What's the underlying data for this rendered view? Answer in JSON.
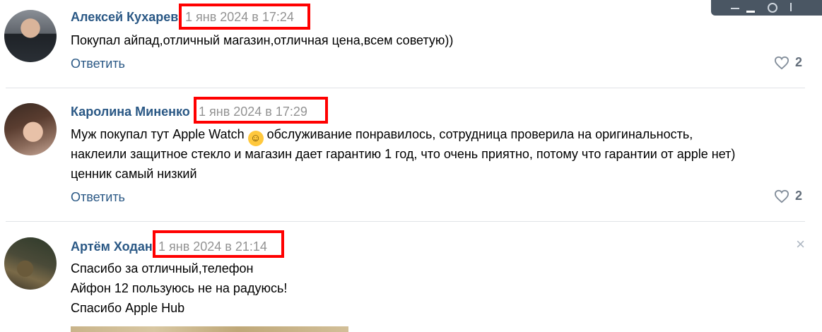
{
  "comments": [
    {
      "author": "Алексей Кухарев",
      "date": "1 янв 2024 в 17:24",
      "lines": [
        "Покупал айпад,отличный магазин,отличная цена,всем советую))"
      ],
      "reply_label": "Ответить",
      "likes": "2"
    },
    {
      "author": "Каролина Миненко",
      "date": "1 янв 2024 в 17:29",
      "lines": [
        "Муж покупал тут Apple Watch",
        "обслуживание понравилось, сотрудница проверила на оригинальность,",
        "наклеили защитное стекло и магазин дает гарантию 1 год, что очень приятно, потому что гарантии от apple нет)",
        "ценник самый низкий"
      ],
      "emoji": "hugging-face-emoji",
      "reply_label": "Ответить",
      "likes": "2"
    },
    {
      "author": "Артём Ходан",
      "date": "1 янв 2024 в 21:14",
      "lines": [
        "Спасибо за отличный,телефон",
        "Айфон 12 пользуюсь не на радуюсь!",
        "Спасибо Apple Hub"
      ],
      "close": "×"
    }
  ],
  "icons": {
    "like": "heart-icon",
    "close": "close-icon"
  },
  "colors": {
    "author": "#2a5885",
    "date": "#939393",
    "highlight": "#ff0000"
  }
}
